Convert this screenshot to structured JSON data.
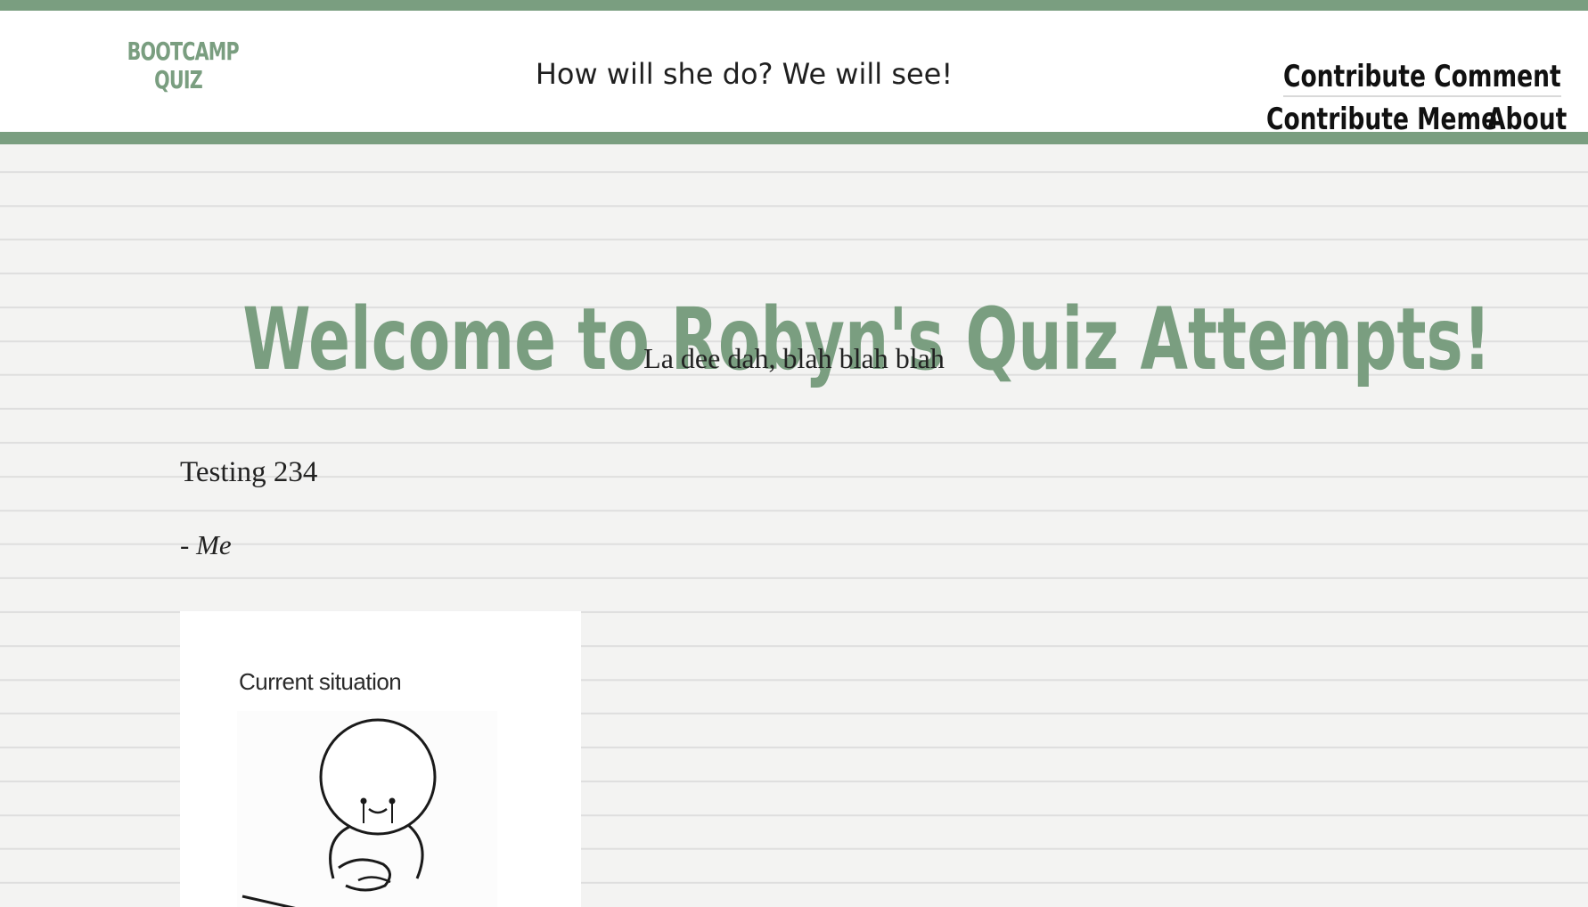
{
  "colors": {
    "accent_green": "#7a9e80",
    "link_text": "#111111"
  },
  "header": {
    "logo_line1": "BOOTCAMP",
    "logo_line2": "QUIZ",
    "tagline": "How will she do? We will see!",
    "nav": {
      "contribute_comment": "Contribute Comment",
      "contribute_meme": "Contribute Meme",
      "about": "About"
    }
  },
  "main": {
    "title": "Welcome to Robyn's Quiz Attempts!",
    "subtitle": "La dee dah, blah blah blah",
    "post": {
      "text": "Testing 234",
      "author": "- Me"
    },
    "meme": {
      "caption": "Current situation",
      "icon": "crying-stick-figure-drawing"
    }
  }
}
